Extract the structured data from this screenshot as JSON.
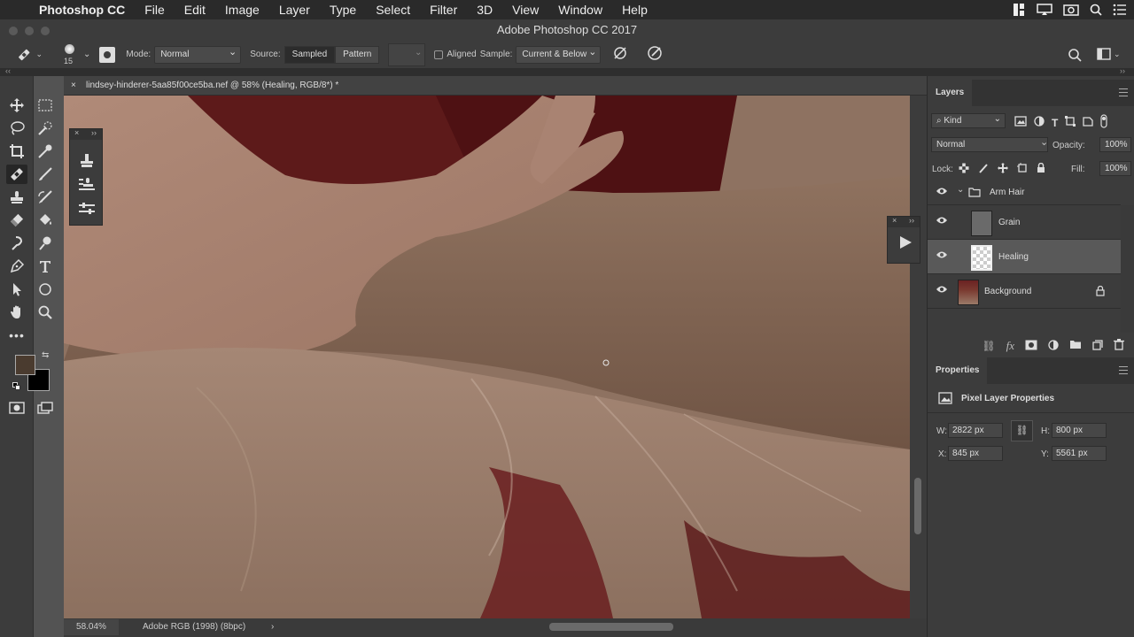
{
  "menubar": {
    "app": "Photoshop CC",
    "items": [
      "File",
      "Edit",
      "Image",
      "Layer",
      "Type",
      "Select",
      "Filter",
      "3D",
      "View",
      "Window",
      "Help"
    ]
  },
  "window": {
    "title": "Adobe Photoshop CC 2017"
  },
  "options": {
    "brush_size": "15",
    "mode_label": "Mode:",
    "mode_value": "Normal",
    "source_label": "Source:",
    "source_sampled": "Sampled",
    "source_pattern": "Pattern",
    "aligned_label": "Aligned",
    "sample_label": "Sample:",
    "sample_value": "Current & Below"
  },
  "document": {
    "tab_title": "lindsey-hinderer-5aa85f00ce5ba.nef @ 58% (Healing, RGB/8*) *",
    "close": "×"
  },
  "status": {
    "zoom": "58.04%",
    "profile": "Adobe RGB (1998) (8bpc)",
    "arrow": "›"
  },
  "layers_panel": {
    "tab": "Layers",
    "filter_kind": "Kind",
    "blend_mode": "Normal",
    "opacity_label": "Opacity:",
    "opacity_value": "100%",
    "lock_label": "Lock:",
    "fill_label": "Fill:",
    "fill_value": "100%",
    "layers": [
      {
        "name": "Arm Hair",
        "type": "group"
      },
      {
        "name": "Grain",
        "type": "layer"
      },
      {
        "name": "Healing",
        "type": "layer",
        "selected": true
      },
      {
        "name": "Background",
        "type": "background",
        "locked": true
      }
    ]
  },
  "properties_panel": {
    "tab": "Properties",
    "title": "Pixel Layer Properties",
    "w_label": "W:",
    "w_value": "2822 px",
    "h_label": "H:",
    "h_value": "800 px",
    "x_label": "X:",
    "x_value": "845 px",
    "y_label": "Y:",
    "y_value": "5561 px"
  },
  "colors": {
    "foreground": "#4a3b2f",
    "background": "#000000",
    "accent": "#595959"
  }
}
